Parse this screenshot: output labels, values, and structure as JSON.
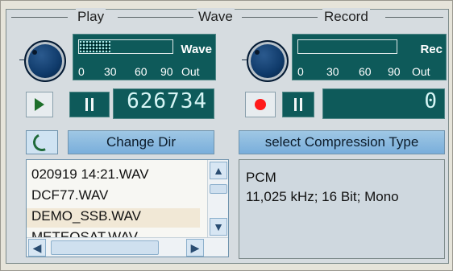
{
  "legend": {
    "play": "Play",
    "wave": "Wave",
    "record": "Record"
  },
  "play": {
    "meter_tag": "Wave",
    "meter_scale": [
      "0",
      "30",
      "60",
      "90",
      "Out"
    ],
    "counter": "626734",
    "meter_level_fraction": 0.33
  },
  "record": {
    "meter_tag": "Rec",
    "meter_scale": [
      "0",
      "30",
      "60",
      "90",
      "Out"
    ],
    "counter": "0",
    "meter_level_fraction": 0.0
  },
  "buttons": {
    "change_dir": "Change Dir",
    "select_compression": "select Compression Type"
  },
  "files": [
    "020919 14:21.WAV",
    "DCF77.WAV",
    "DEMO_SSB.WAV",
    "METEOSAT.WAV"
  ],
  "selected_file_index": 2,
  "compression": {
    "format": "PCM",
    "details": "11,025 kHz; 16 Bit; Mono"
  },
  "colors": {
    "lcd_bg": "#0e5a5a",
    "record_dot": "#ff1a1a",
    "play_arrow": "#1d6f2a"
  },
  "icons": {
    "play": "play-icon",
    "pause": "pause-icon",
    "record": "record-icon",
    "refresh": "refresh-icon",
    "knob": "volume-knob-icon"
  }
}
